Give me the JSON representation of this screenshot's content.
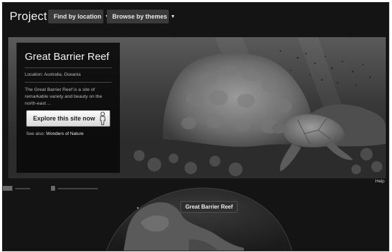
{
  "header": {
    "brand": "Project",
    "nav": [
      {
        "label": "Find by location",
        "icon": "caret-down-icon"
      },
      {
        "label": "Browse by themes",
        "icon": "caret-down-icon"
      }
    ]
  },
  "feature": {
    "title": "Great Barrier Reef",
    "location": "Location: Australia, Oceania",
    "description": "The Great Barrier Reef is a site of remarkable variety and beauty on the north-east ...",
    "explore_label": "Explore this site now",
    "explore_icon": "pegman-icon",
    "see_also_prefix": "See also:",
    "see_also_link": "Wonders of Nature"
  },
  "help_label": "Help",
  "globe": {
    "marker_label": "Great Barrier Reef"
  },
  "colors": {
    "background": "#141414",
    "nav_button": "#3a3a3a",
    "card": "#080808",
    "text_light": "#f4f4f4"
  }
}
